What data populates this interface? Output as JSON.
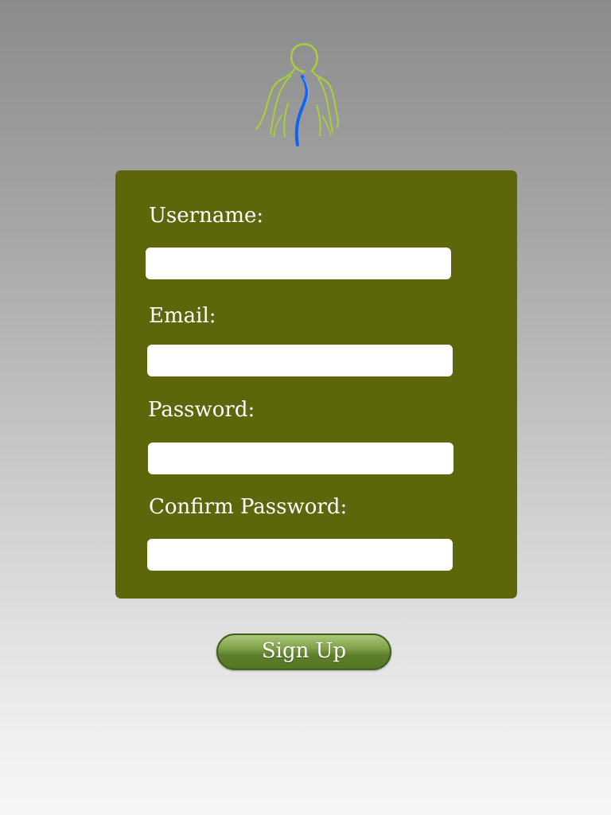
{
  "logo": {
    "icon": "spine-body-icon",
    "colors": {
      "outline": "#a7cf3b",
      "spine": "#1463f0"
    }
  },
  "form": {
    "background": "#5e660b",
    "fields": {
      "username": {
        "label": "Username:",
        "value": "",
        "placeholder": ""
      },
      "email": {
        "label": "Email:",
        "value": "",
        "placeholder": ""
      },
      "password": {
        "label": "Password:",
        "value": "",
        "placeholder": ""
      },
      "confirm_password": {
        "label": "Confirm Password:",
        "value": "",
        "placeholder": ""
      }
    }
  },
  "actions": {
    "signup_label": "Sign Up",
    "signup_color": "#6b8e34"
  }
}
